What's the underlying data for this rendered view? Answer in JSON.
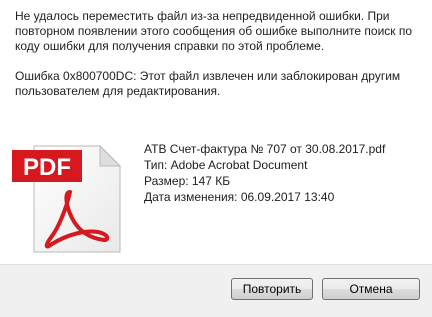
{
  "message": {
    "error_text": "Не удалось переместить файл из-за непредвиденной ошибки. При повторном появлении этого сообщения об ошибке выполните поиск по коду ошибки для получения справки по этой проблеме.",
    "error_code_text": "Ошибка 0x800700DC: Этот файл извлечен или заблокирован другим пользователем для редактирования."
  },
  "file": {
    "icon": "pdf-file-icon",
    "icon_label": "PDF",
    "name": "ATB Счет-фактура № 707 от 30.08.2017.pdf",
    "type": "Тип: Adobe Acrobat Document",
    "size": "Размер: 147 КБ",
    "modified": "Дата изменения: 06.09.2017 13:40"
  },
  "buttons": {
    "retry_label": "Повторить",
    "cancel_label": "Отмена"
  },
  "colors": {
    "pdf_red": "#d6181f",
    "footer_bg": "#f0f0f0"
  }
}
